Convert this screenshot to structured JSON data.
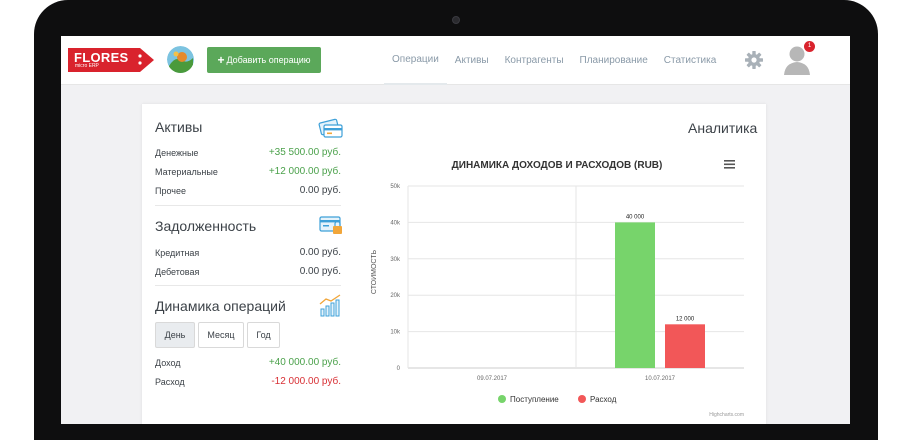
{
  "header": {
    "logo_text": "FLORES",
    "logo_sub": "micro ERP",
    "add_button_label": "Добавить операцию",
    "nav": [
      {
        "label": "Операции",
        "active": true
      },
      {
        "label": "Активы",
        "active": false
      },
      {
        "label": "Контрагенты",
        "active": false
      },
      {
        "label": "Планирование",
        "active": false
      },
      {
        "label": "Статистика",
        "active": false
      }
    ],
    "notification_count": "1",
    "colors": {
      "logo": "#d9232d",
      "add_button": "#5ba85a",
      "badge": "#d9232d"
    },
    "icons": {
      "settings": "gear-icon",
      "user": "user-avatar-icon",
      "company": "company-avatar"
    }
  },
  "assets": {
    "title": "Активы",
    "rows": [
      {
        "label": "Денежные",
        "value": "+35 500.00 руб.",
        "tone": "green"
      },
      {
        "label": "Материальные",
        "value": "+12 000.00 руб.",
        "tone": "green"
      },
      {
        "label": "Прочее",
        "value": "0.00 руб.",
        "tone": "grey"
      }
    ],
    "icon": "cards-icon"
  },
  "debts": {
    "title": "Задолженность",
    "rows": [
      {
        "label": "Кредитная",
        "value": "0.00 руб.",
        "tone": "grey"
      },
      {
        "label": "Дебетовая",
        "value": "0.00 руб.",
        "tone": "grey"
      }
    ],
    "icon": "credit-card-lock-icon"
  },
  "dynamics": {
    "title": "Динамика операций",
    "periods": [
      {
        "label": "День",
        "active": true
      },
      {
        "label": "Месяц",
        "active": false
      },
      {
        "label": "Год",
        "active": false
      }
    ],
    "rows": [
      {
        "label": "Доход",
        "value": "+40 000.00 руб.",
        "tone": "green"
      },
      {
        "label": "Расход",
        "value": "-12 000.00 руб.",
        "tone": "red"
      }
    ],
    "icon": "growth-chart-icon"
  },
  "analytics": {
    "title": "Аналитика",
    "menu_icon": "hamburger-menu-icon",
    "credits": "Highcharts.com"
  },
  "chart_data": {
    "type": "bar",
    "title": "ДИНАМИКА ДОХОДОВ И РАСХОДОВ (RUB)",
    "ylabel": "СТОИМОСТЬ",
    "xlabel": "",
    "categories": [
      "09.07.2017",
      "10.07.2017"
    ],
    "ylim": [
      0,
      50000
    ],
    "yticks": [
      0,
      10000,
      20000,
      30000,
      40000,
      50000
    ],
    "ytick_labels": [
      "0",
      "10k",
      "20k",
      "30k",
      "40k",
      "50k"
    ],
    "series": [
      {
        "name": "Поступление",
        "values": [
          0,
          40000
        ],
        "labels": [
          "",
          "40 000"
        ],
        "color": "#77d46b"
      },
      {
        "name": "Расход",
        "values": [
          0,
          12000
        ],
        "labels": [
          "",
          "12 000"
        ],
        "color": "#f25758"
      }
    ],
    "grid": true,
    "legend_position": "bottom-center"
  }
}
